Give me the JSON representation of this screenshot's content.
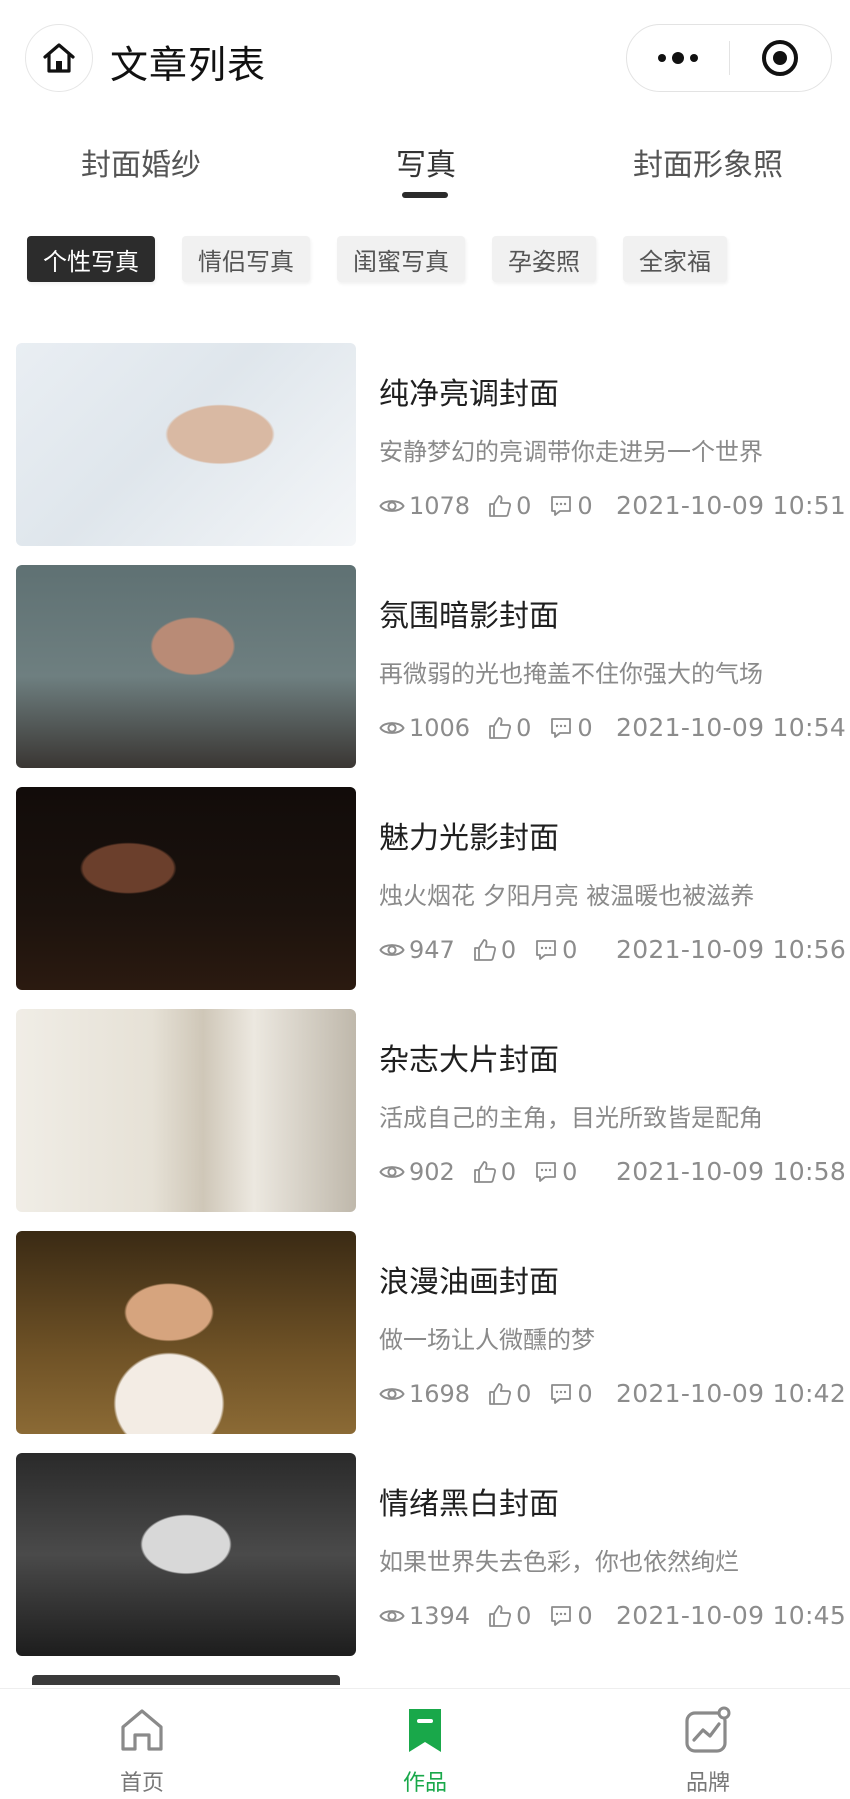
{
  "header": {
    "title": "文章列表",
    "home_icon": "home-icon",
    "more_icon": "more-dots-icon",
    "target_icon": "target-circle-icon"
  },
  "tabs": [
    {
      "label": "封面婚纱",
      "active": false
    },
    {
      "label": "写真",
      "active": true
    },
    {
      "label": "封面形象照",
      "active": false
    }
  ],
  "chips": [
    {
      "label": "个性写真",
      "active": true
    },
    {
      "label": "情侣写真",
      "active": false
    },
    {
      "label": "闺蜜写真",
      "active": false
    },
    {
      "label": "孕姿照",
      "active": false
    },
    {
      "label": "全家福",
      "active": false
    }
  ],
  "articles": [
    {
      "title": "纯净亮调封面",
      "desc": "安静梦幻的亮调带你走进另一个世界",
      "views": "1078",
      "likes": "0",
      "comments": "0",
      "date": "2021-10-09 10:51"
    },
    {
      "title": "氛围暗影封面",
      "desc": "再微弱的光也掩盖不住你强大的气场",
      "views": "1006",
      "likes": "0",
      "comments": "0",
      "date": "2021-10-09 10:54"
    },
    {
      "title": "魅力光影封面",
      "desc": "烛火烟花 夕阳月亮 被温暖也被滋养",
      "views": "947",
      "likes": "0",
      "comments": "0",
      "date": "2021-10-09 10:56"
    },
    {
      "title": "杂志大片封面",
      "desc": "活成自己的主角，目光所致皆是配角",
      "views": "902",
      "likes": "0",
      "comments": "0",
      "date": "2021-10-09 10:58"
    },
    {
      "title": "浪漫油画封面",
      "desc": "做一场让人微醺的梦",
      "views": "1698",
      "likes": "0",
      "comments": "0",
      "date": "2021-10-09 10:42"
    },
    {
      "title": "情绪黑白封面",
      "desc": "如果世界失去色彩，你也依然绚烂",
      "views": "1394",
      "likes": "0",
      "comments": "0",
      "date": "2021-10-09 10:45"
    }
  ],
  "tabbar": [
    {
      "label": "首页",
      "icon": "home-outline-icon",
      "active": false
    },
    {
      "label": "作品",
      "icon": "bookmark-icon",
      "active": true
    },
    {
      "label": "品牌",
      "icon": "trend-chart-icon",
      "active": false
    }
  ],
  "colors": {
    "accent": "#19a84a",
    "chip_active": "#2c2c2c",
    "chip_inactive": "#f1f1f1",
    "text_secondary": "#8a8a8a"
  }
}
